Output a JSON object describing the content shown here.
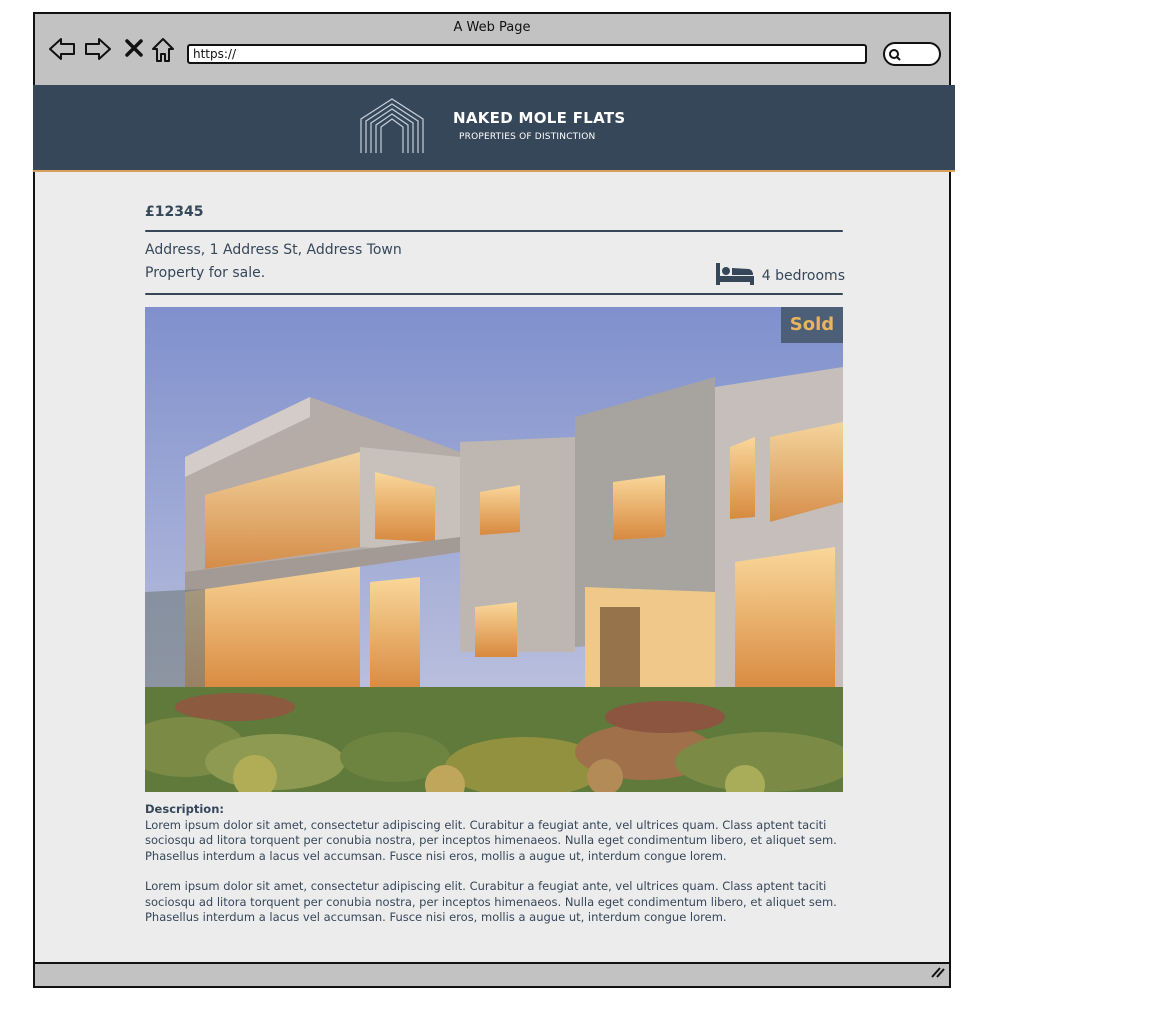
{
  "window": {
    "title": "A Web Page"
  },
  "browser": {
    "url": "https://"
  },
  "icons": [
    "back-icon",
    "forward-icon",
    "close-icon",
    "home-icon",
    "search-icon",
    "bed-icon",
    "resize-grip-icon"
  ],
  "brand": {
    "name": "NAKED MOLE FLATS",
    "tagline": "PROPERTIES OF DISTINCTION"
  },
  "listing": {
    "price": "£12345",
    "address": "Address, 1 Address St, Address Town",
    "sale_type": "Property for sale.",
    "bedrooms": "4 bedrooms",
    "status_badge": "Sold"
  },
  "description": {
    "label": "Description:",
    "paragraphs": [
      "Lorem ipsum dolor sit amet, consectetur adipiscing elit. Curabitur a feugiat ante, vel ultrices quam. Class aptent taciti sociosqu ad litora torquent per conubia nostra, per inceptos himenaeos. Nulla eget condimentum libero, et aliquet sem. Phasellus interdum a lacus vel accumsan. Fusce nisi eros, mollis a augue ut, interdum congue lorem.",
      "Lorem ipsum dolor sit amet, consectetur adipiscing elit. Curabitur a feugiat ante, vel ultrices quam. Class aptent taciti sociosqu ad litora torquent per conubia nostra, per inceptos himenaeos. Nulla eget condimentum libero, et aliquet sem. Phasellus interdum a lacus vel accumsan. Fusce nisi eros, mollis a augue ut, interdum congue lorem."
    ]
  },
  "colors": {
    "header_bg": "#36475a",
    "accent": "#d9a05b",
    "sold_text": "#e8b55e",
    "sold_bg": "#4d5f77"
  }
}
